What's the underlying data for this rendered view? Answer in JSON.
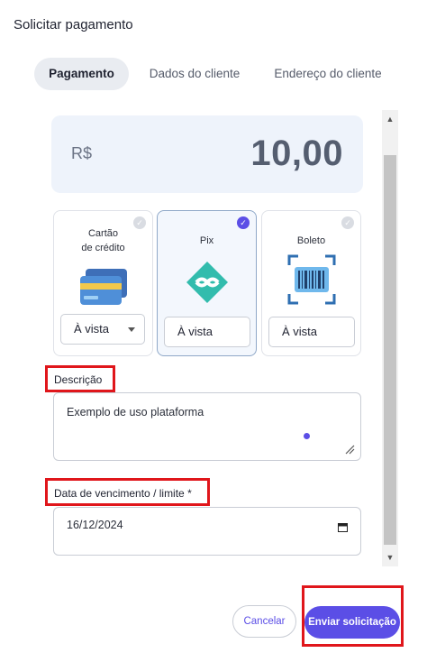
{
  "dialog": {
    "title": "Solicitar pagamento"
  },
  "tabs": [
    {
      "label": "Pagamento",
      "active": true
    },
    {
      "label": "Dados do cliente",
      "active": false
    },
    {
      "label": "Endereço do cliente",
      "active": false
    }
  ],
  "amount": {
    "currency": "R$",
    "value": "10,00"
  },
  "payment_methods": [
    {
      "label_line1": "Cartão",
      "label_line2": "de crédito",
      "option": "À vista",
      "selected": false,
      "icon": "credit-card-icon"
    },
    {
      "label_line1": "Pix",
      "label_line2": "",
      "option": "À vista",
      "selected": true,
      "icon": "pix-icon"
    },
    {
      "label_line1": "Boleto",
      "label_line2": "",
      "option": "À vista",
      "selected": false,
      "icon": "barcode-icon"
    }
  ],
  "description": {
    "label": "Descrição",
    "value": "Exemplo de uso plataforma"
  },
  "due_date": {
    "label": "Data de vencimento / limite *",
    "value": "16/12/2024"
  },
  "footer": {
    "cancel_label": "Cancelar",
    "submit_label": "Enviar solicitação"
  },
  "colors": {
    "accent": "#5b4ee6",
    "highlight": "#e0161b",
    "amount_bg": "#eef3fb"
  }
}
